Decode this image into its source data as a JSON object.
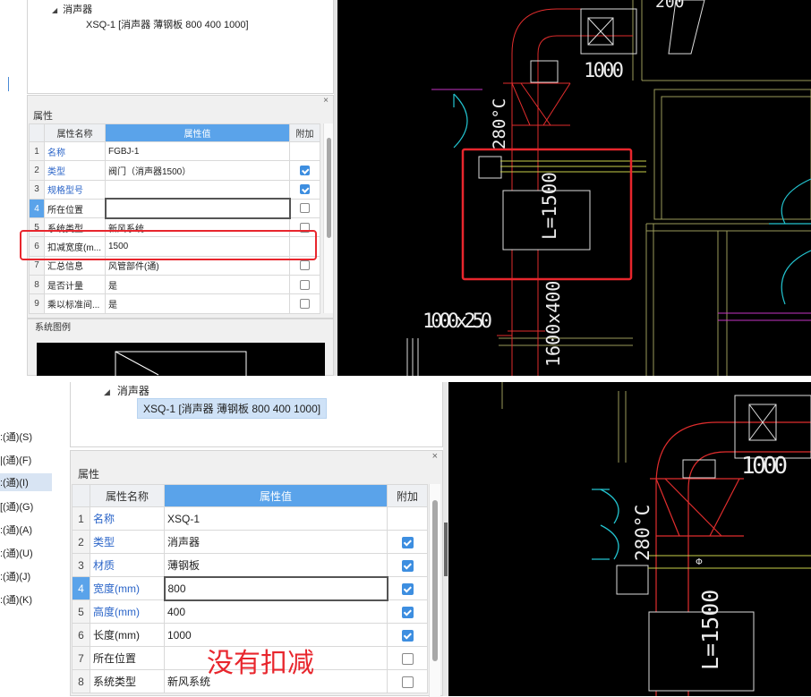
{
  "top": {
    "tree": {
      "root_label": "消声器",
      "leaf_label": "XSQ-1 [消声器 薄钢板 800 400 1000]"
    },
    "properties": {
      "title": "属性",
      "headers": {
        "index": "",
        "name": "属性名称",
        "value": "属性值",
        "extra": "附加"
      },
      "rows": [
        {
          "no": "1",
          "name": "名称",
          "value": "FGBJ-1",
          "checked": null,
          "link": true
        },
        {
          "no": "2",
          "name": "类型",
          "value": "阀门（消声器1500）",
          "checked": true,
          "link": true
        },
        {
          "no": "3",
          "name": "规格型号",
          "value": "",
          "checked": true,
          "link": true
        },
        {
          "no": "4",
          "name": "所在位置",
          "value": "",
          "checked": false,
          "link": false
        },
        {
          "no": "5",
          "name": "系统类型",
          "value": "新风系统",
          "checked": false,
          "link": false
        },
        {
          "no": "6",
          "name": "扣减宽度(m...",
          "value": "1500",
          "checked": null,
          "link": false
        },
        {
          "no": "7",
          "name": "汇总信息",
          "value": "风管部件(通)",
          "checked": false,
          "link": false
        },
        {
          "no": "8",
          "name": "是否计量",
          "value": "是",
          "checked": false,
          "link": false
        },
        {
          "no": "9",
          "name": "乘以标准间...",
          "value": "是",
          "checked": false,
          "link": false
        }
      ]
    },
    "legend_title": "系统图例",
    "cad": {
      "dim_top": "1000",
      "temp_label": "280°C",
      "silencer_label": "L=1500",
      "duct_label": "1000x250",
      "duct_vertical_label": "1600x400",
      "partial_top": "200"
    }
  },
  "bottom": {
    "side_list": [
      ":(通)(S)",
      "|(通)(F)",
      ":(通)(I)",
      "[(通)(G)",
      ":(通)(A)",
      ":(通)(U)",
      ":(通)(J)",
      ":(通)(K)"
    ],
    "tree": {
      "root_label": "消声器",
      "leaf_label": "XSQ-1 [消声器 薄钢板 800 400 1000]"
    },
    "properties": {
      "title": "属性",
      "headers": {
        "index": "",
        "name": "属性名称",
        "value": "属性值",
        "extra": "附加"
      },
      "rows": [
        {
          "no": "1",
          "name": "名称",
          "value": "XSQ-1",
          "checked": null,
          "link": true
        },
        {
          "no": "2",
          "name": "类型",
          "value": "消声器",
          "checked": true,
          "link": true
        },
        {
          "no": "3",
          "name": "材质",
          "value": "薄钢板",
          "checked": true,
          "link": true
        },
        {
          "no": "4",
          "name": "宽度(mm)",
          "value": "800",
          "checked": true,
          "link": true
        },
        {
          "no": "5",
          "name": "高度(mm)",
          "value": "400",
          "checked": true,
          "link": true
        },
        {
          "no": "6",
          "name": "长度(mm)",
          "value": "1000",
          "checked": true,
          "link": false
        },
        {
          "no": "7",
          "name": "所在位置",
          "value": "",
          "checked": false,
          "link": false
        },
        {
          "no": "8",
          "name": "系统类型",
          "value": "新风系统",
          "checked": false,
          "link": false
        }
      ]
    },
    "annotation": "没有扣减",
    "cad": {
      "dim_top": "1000",
      "temp_label": "280°C",
      "silencer_label": "L=1500",
      "phi": "Φ"
    }
  }
}
